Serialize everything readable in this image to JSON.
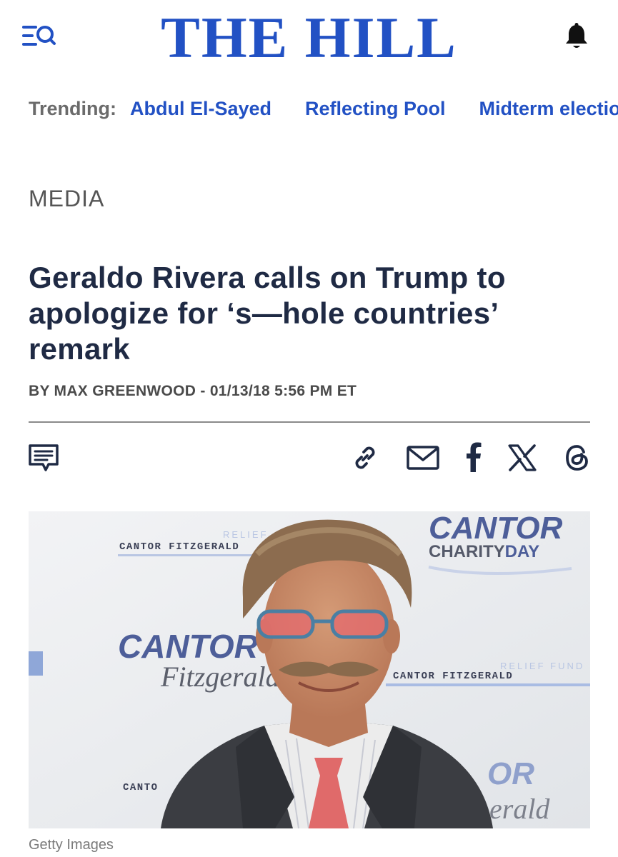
{
  "header": {
    "logo": "THE HILL",
    "menu_icon": "menu-search-icon",
    "notification_icon": "bell-icon"
  },
  "trending": {
    "label": "Trending:",
    "links": [
      "Abdul El-Sayed",
      "Reflecting Pool",
      "Midterm elections"
    ]
  },
  "article": {
    "section": "MEDIA",
    "headline": "Geraldo Rivera calls on Trump to apologize for ‘s—hole countries’ remark",
    "byline": "BY MAX GREENWOOD - 01/13/18 5:56 PM ET",
    "share_icons": [
      "comments-icon",
      "link-icon",
      "email-icon",
      "facebook-icon",
      "x-icon",
      "threads-icon"
    ],
    "photo": {
      "backdrop_texts": {
        "cantor_fitzgerald_1": "CANTOR FITZGERALD",
        "relief_1": "RELIEF",
        "cantor_big": "CANTOR",
        "charity_prefix": "CHARITY",
        "charity_suffix": "DAY",
        "cantor_mid": "CANTOR",
        "fitzgerald_script": "Fitzgerald",
        "relief_fund": "RELIEF FUND",
        "cantor_fitzgerald_2": "CANTOR FITZGERALD",
        "canto_partial": "CANTO",
        "or_partial": "OR",
        "erald_script": "erald"
      }
    },
    "caption": "Getty Images"
  },
  "colors": {
    "brand_blue": "#2251c4",
    "headline": "#1f2a44",
    "muted": "#6b6b6b"
  }
}
